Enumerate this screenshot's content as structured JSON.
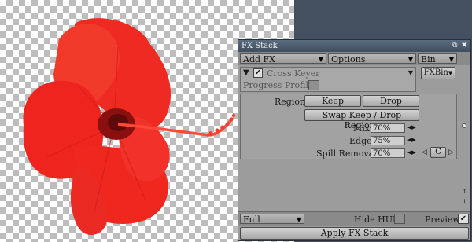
{
  "panel": {
    "title": "FX Stack",
    "title_icons": [
      "restore-icon",
      "close-icon"
    ]
  },
  "menubar": {
    "add_fx": "Add FX",
    "options": "Options",
    "bin": "Bin"
  },
  "effect": {
    "name": "Cross Keyer",
    "enabled": true,
    "bin_button": "FXBin",
    "progress_label": "Progress Profile"
  },
  "controls": {
    "region_label": "Region",
    "keep_button": "Keep",
    "drop_button": "Drop",
    "swap_button": "Swap Keep / Drop Regions",
    "mix_label": "Mix",
    "mix_value": "70%",
    "edge_label": "Edge",
    "edge_value": "75%",
    "spill_label": "Spill Removal",
    "spill_value": "70%",
    "c_button": "C"
  },
  "footer": {
    "mode": "Full",
    "hide_hud": "Hide HUD",
    "preview": "Preview",
    "apply": "Apply FX Stack"
  },
  "colors": {
    "flower": "#f0241f",
    "panel": "#9c9c9c",
    "titlebar": "#4a5a6c",
    "background": "#44505f"
  }
}
